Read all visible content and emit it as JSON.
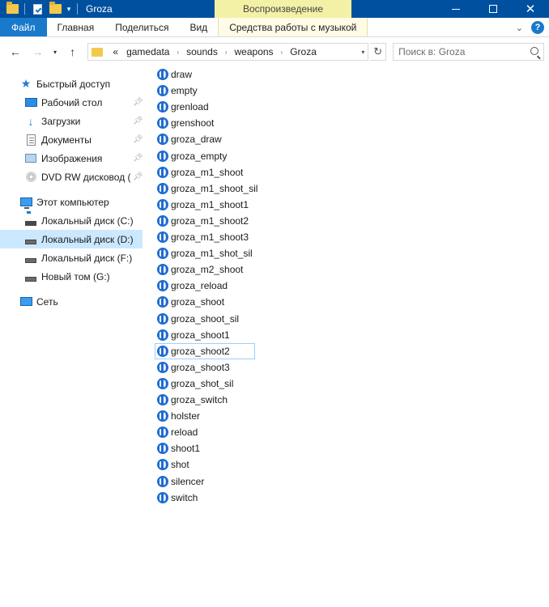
{
  "window": {
    "title": "Groza",
    "context_tab_band": "Воспроизведение"
  },
  "ribbon": {
    "tabs": [
      {
        "label": "Файл"
      },
      {
        "label": "Главная"
      },
      {
        "label": "Поделиться"
      },
      {
        "label": "Вид"
      },
      {
        "label": "Средства работы с музыкой"
      }
    ],
    "help_label": "?"
  },
  "address": {
    "overflow": "«",
    "crumbs": [
      "gamedata",
      "sounds",
      "weapons",
      "Groza"
    ]
  },
  "search": {
    "placeholder": "Поиск в: Groza"
  },
  "nav_pane": {
    "quick_access": "Быстрый доступ",
    "quick_items": [
      {
        "label": "Рабочий стол"
      },
      {
        "label": "Загрузки"
      },
      {
        "label": "Документы"
      },
      {
        "label": "Изображения"
      },
      {
        "label": "DVD RW дисковод ("
      }
    ],
    "this_pc": "Этот компьютер",
    "drives": [
      {
        "label": "Локальный диск (C:)"
      },
      {
        "label": "Локальный диск (D:)"
      },
      {
        "label": "Локальный диск (F:)"
      },
      {
        "label": "Новый том (G:)"
      }
    ],
    "network": "Сеть"
  },
  "files": [
    "draw",
    "empty",
    "grenload",
    "grenshoot",
    "groza_draw",
    "groza_empty",
    "groza_m1_shoot",
    "groza_m1_shoot_sil",
    "groza_m1_shoot1",
    "groza_m1_shoot2",
    "groza_m1_shoot3",
    "groza_m1_shot_sil",
    "groza_m2_shoot",
    "groza_reload",
    "groza_shoot",
    "groza_shoot_sil",
    "groza_shoot1",
    "groza_shoot2",
    "groza_shoot3",
    "groza_shot_sil",
    "groza_switch",
    "holster",
    "reload",
    "shoot1",
    "shot",
    "silencer",
    "switch"
  ],
  "colors": {
    "titlebar": "#0050a0",
    "file_tab": "#1979ca",
    "context_band": "#f3f1a6",
    "selection": "#cce8ff",
    "focus_border": "#99d1ff"
  }
}
